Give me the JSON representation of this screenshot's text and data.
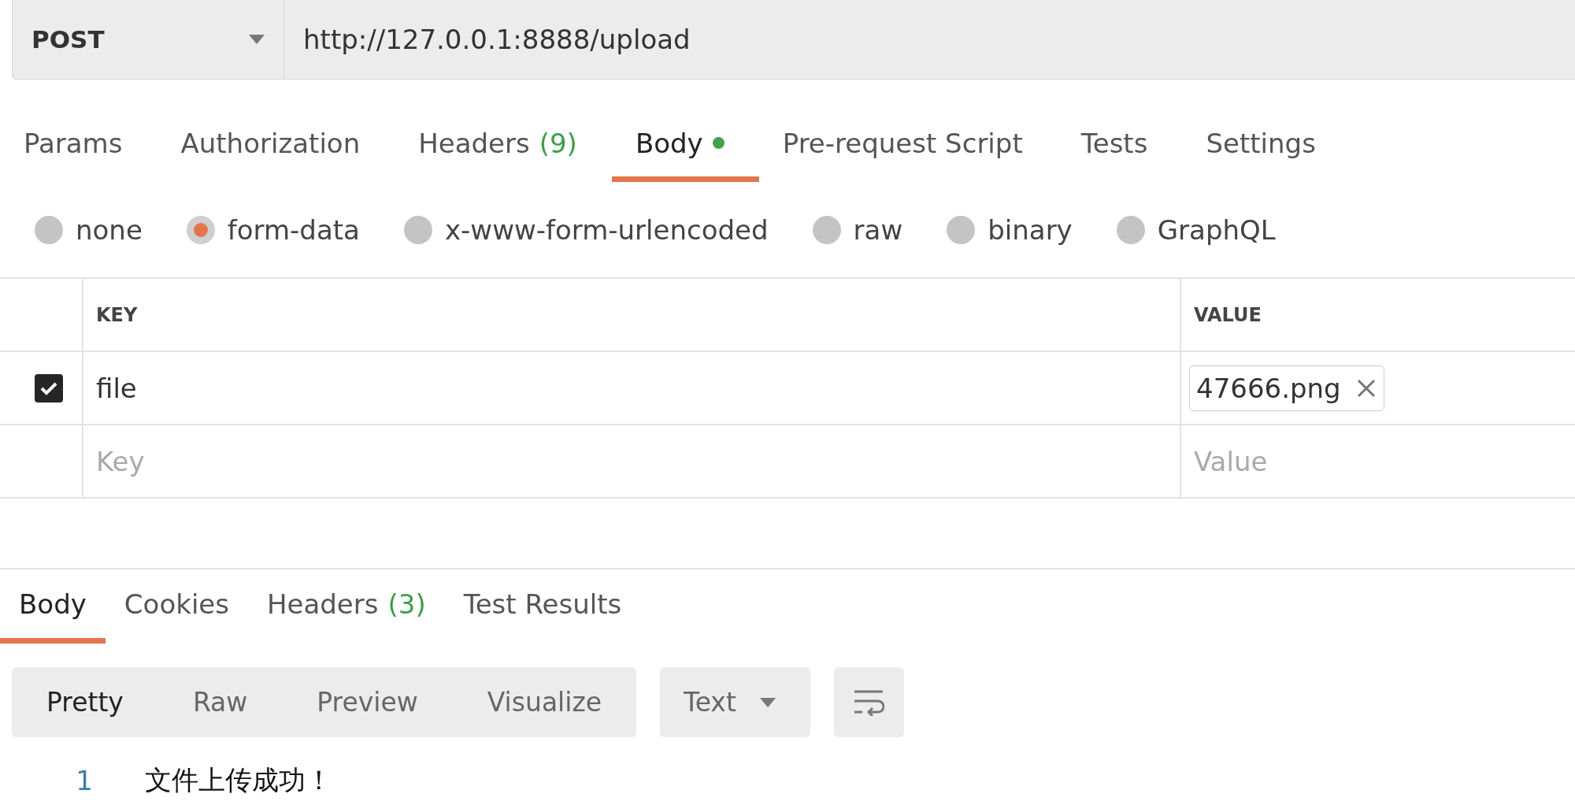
{
  "request": {
    "method": "POST",
    "url": "http://127.0.0.1:8888/upload"
  },
  "request_tabs": [
    {
      "label": "Params",
      "selected": false
    },
    {
      "label": "Authorization",
      "selected": false
    },
    {
      "label": "Headers",
      "count": "(9)",
      "selected": false
    },
    {
      "label": "Body",
      "has_content": true,
      "selected": true
    },
    {
      "label": "Pre-request Script",
      "selected": false
    },
    {
      "label": "Tests",
      "selected": false
    },
    {
      "label": "Settings",
      "selected": false
    }
  ],
  "body_types": [
    {
      "label": "none",
      "selected": false
    },
    {
      "label": "form-data",
      "selected": true
    },
    {
      "label": "x-www-form-urlencoded",
      "selected": false
    },
    {
      "label": "raw",
      "selected": false
    },
    {
      "label": "binary",
      "selected": false
    },
    {
      "label": "GraphQL",
      "selected": false
    }
  ],
  "params_table": {
    "columns": [
      "KEY",
      "VALUE"
    ],
    "rows": [
      {
        "checked": true,
        "key": "file",
        "value": "47666.png"
      }
    ],
    "new_row": {
      "key_placeholder": "Key",
      "value_placeholder": "Value"
    }
  },
  "response_tabs": [
    {
      "label": "Body",
      "selected": true
    },
    {
      "label": "Cookies",
      "selected": false
    },
    {
      "label": "Headers",
      "count": "(3)",
      "selected": false
    },
    {
      "label": "Test Results",
      "selected": false
    }
  ],
  "view_modes": [
    {
      "label": "Pretty",
      "selected": true
    },
    {
      "label": "Raw",
      "selected": false
    },
    {
      "label": "Preview",
      "selected": false
    },
    {
      "label": "Visualize",
      "selected": false
    }
  ],
  "format": "Text",
  "response_lines": [
    {
      "number": "1",
      "text": "文件上传成功！"
    }
  ]
}
